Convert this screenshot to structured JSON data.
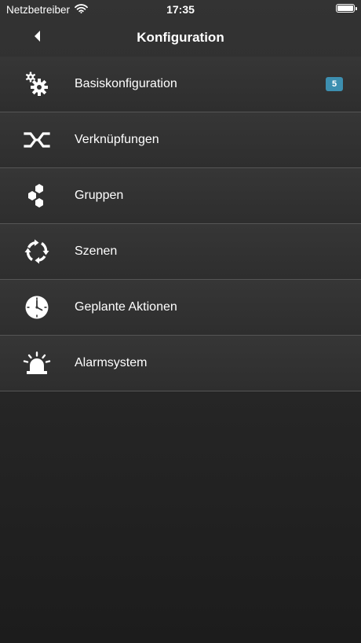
{
  "status_bar": {
    "carrier": "Netzbetreiber",
    "time": "17:35",
    "battery_level": 1.0
  },
  "nav": {
    "title": "Konfiguration",
    "back_icon": "chevron-left-icon"
  },
  "menu": {
    "items": [
      {
        "label": "Basiskonfiguration",
        "icon": "gears-icon",
        "badge": "5"
      },
      {
        "label": "Verknüpfungen",
        "icon": "links-icon"
      },
      {
        "label": "Gruppen",
        "icon": "hexagons-icon"
      },
      {
        "label": "Szenen",
        "icon": "cycle-arrows-icon"
      },
      {
        "label": "Geplante Aktionen",
        "icon": "clock-icon"
      },
      {
        "label": "Alarmsystem",
        "icon": "siren-icon"
      }
    ]
  },
  "colors": {
    "badge_background": "#3d8fb0",
    "separator": "#555555",
    "background_top": "#333333",
    "background_bottom": "#1c1c1c"
  }
}
